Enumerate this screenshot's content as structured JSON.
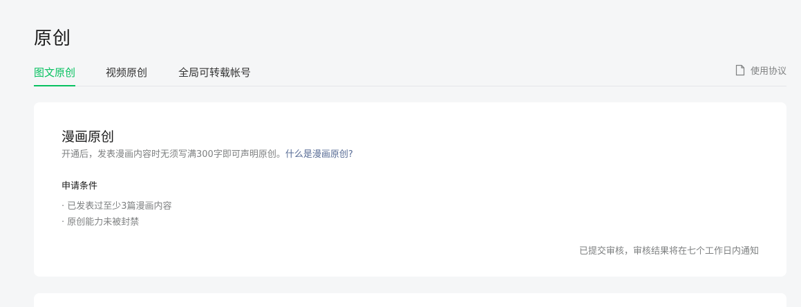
{
  "page": {
    "title": "原创"
  },
  "tabs": [
    {
      "label": "图文原创",
      "active": true
    },
    {
      "label": "视频原创",
      "active": false
    },
    {
      "label": "全局可转载帐号",
      "active": false
    }
  ],
  "agreement": {
    "label": "使用协议",
    "icon": "document-icon"
  },
  "comic_card": {
    "title": "漫画原创",
    "description": "开通后，发表漫画内容时无须写满300字即可声明原创。",
    "link_text": "什么是漫画原创?",
    "conditions_title": "申请条件",
    "conditions": [
      "· 已发表过至少3篇漫画内容",
      "· 原创能力未被封禁"
    ],
    "status": "已提交审核，审核结果将在七个工作日内通知"
  },
  "colors": {
    "accent": "#07c160",
    "link": "#576b95",
    "background": "#f5f6f7"
  }
}
